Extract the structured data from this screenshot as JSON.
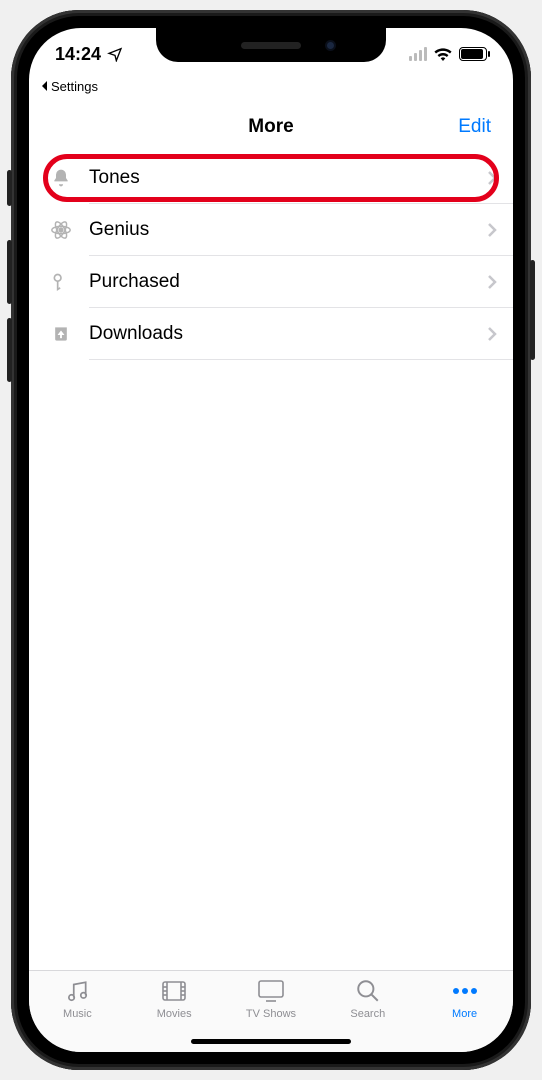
{
  "status": {
    "time": "14:24",
    "backApp": "Settings"
  },
  "nav": {
    "title": "More",
    "edit": "Edit"
  },
  "list": {
    "items": [
      {
        "icon": "bell-icon",
        "label": "Tones",
        "highlighted": true
      },
      {
        "icon": "atom-icon",
        "label": "Genius",
        "highlighted": false
      },
      {
        "icon": "key-icon",
        "label": "Purchased",
        "highlighted": false
      },
      {
        "icon": "download-icon",
        "label": "Downloads",
        "highlighted": false
      }
    ]
  },
  "tabs": {
    "items": [
      {
        "icon": "music-icon",
        "label": "Music",
        "active": false
      },
      {
        "icon": "movie-icon",
        "label": "Movies",
        "active": false
      },
      {
        "icon": "tv-icon",
        "label": "TV Shows",
        "active": false
      },
      {
        "icon": "search-icon",
        "label": "Search",
        "active": false
      },
      {
        "icon": "more-icon",
        "label": "More",
        "active": true
      }
    ]
  }
}
